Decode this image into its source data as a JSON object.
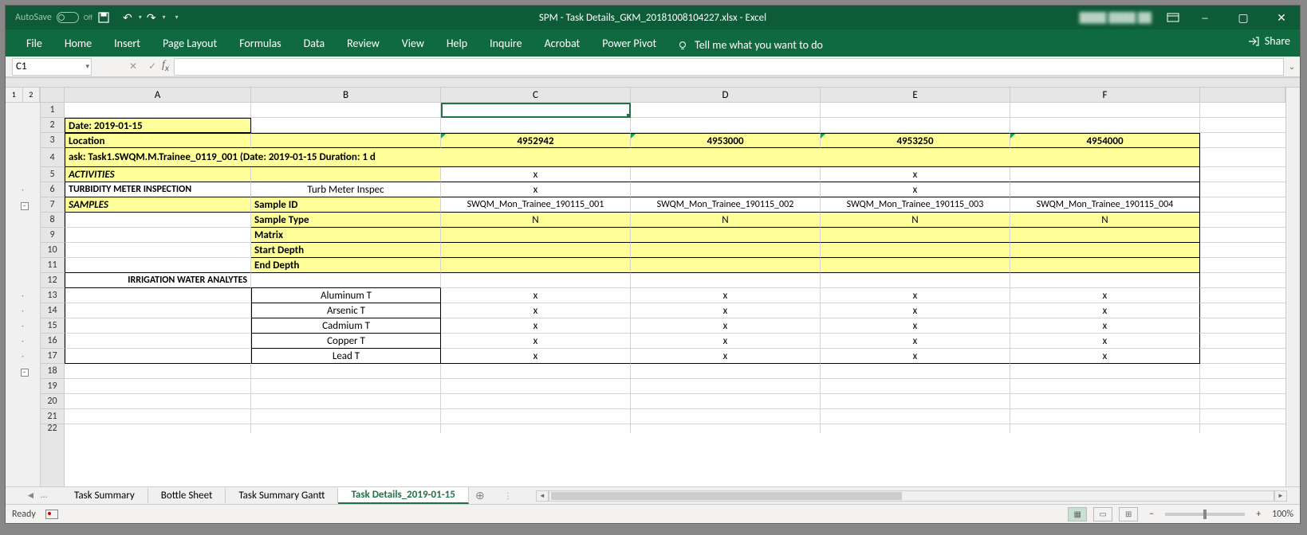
{
  "titlebar": {
    "autosave_label": "AutoSave",
    "autosave_state": "Off",
    "filename": "SPM - Task Details_GKM_20181008104227.xlsx  -  Excel"
  },
  "ribbon": {
    "tabs": [
      "File",
      "Home",
      "Insert",
      "Page Layout",
      "Formulas",
      "Data",
      "Review",
      "View",
      "Help",
      "Inquire",
      "Acrobat",
      "Power Pivot"
    ],
    "tellme": "Tell me what you want to do",
    "share": "Share"
  },
  "namebox": {
    "cell_ref": "C1"
  },
  "outline_levels": [
    "1",
    "2"
  ],
  "columns": [
    "A",
    "B",
    "C",
    "D",
    "E",
    "F"
  ],
  "row_numbers": [
    "1",
    "2",
    "3",
    "4",
    "5",
    "6",
    "7",
    "8",
    "9",
    "10",
    "11",
    "12",
    "13",
    "14",
    "15",
    "16",
    "17",
    "18",
    "19",
    "20",
    "21",
    "22"
  ],
  "sheet": {
    "date_row": "Date: 2019-01-15",
    "location_label": "Location",
    "locations": [
      "4952942",
      "4953000",
      "4953250",
      "4954000"
    ],
    "task_row": "ask: Task1.SWQM.M.Trainee_0119_001 (Date: 2019-01-15 Duration: 1 d",
    "activities_label": "ACTIVITIES",
    "activities_marks": [
      "x",
      "",
      "x",
      ""
    ],
    "turb_label": "TURBIDITY METER INSPECTION",
    "turb_b": "Turb Meter Inspec",
    "turb_marks": [
      "x",
      "",
      "x",
      ""
    ],
    "samples_label": "SAMPLES",
    "sampleid_label": "Sample ID",
    "sample_ids": [
      "SWQM_Mon_Trainee_190115_001",
      "SWQM_Mon_Trainee_190115_002",
      "SWQM_Mon_Trainee_190115_003",
      "SWQM_Mon_Trainee_190115_004"
    ],
    "sampletype_label": "Sample Type",
    "sampletype_vals": [
      "N",
      "N",
      "N",
      "N"
    ],
    "matrix_label": "Matrix",
    "start_depth_label": "Start Depth",
    "end_depth_label": "End Depth",
    "irrigation_label": "IRRIGATION WATER ANALYTES",
    "analytes": [
      {
        "name": "Aluminum T",
        "marks": [
          "x",
          "x",
          "x",
          "x"
        ]
      },
      {
        "name": "Arsenic T",
        "marks": [
          "x",
          "x",
          "x",
          "x"
        ]
      },
      {
        "name": "Cadmium T",
        "marks": [
          "x",
          "x",
          "x",
          "x"
        ]
      },
      {
        "name": "Copper T",
        "marks": [
          "x",
          "x",
          "x",
          "x"
        ]
      },
      {
        "name": "Lead T",
        "marks": [
          "x",
          "x",
          "x",
          "x"
        ]
      }
    ]
  },
  "sheet_tabs": {
    "tabs": [
      "Task Summary",
      "Bottle Sheet",
      "Task Summary Gantt",
      "Task Details_2019-01-15"
    ],
    "ellipsis": "..."
  },
  "status": {
    "ready": "Ready",
    "zoom": "100%"
  }
}
